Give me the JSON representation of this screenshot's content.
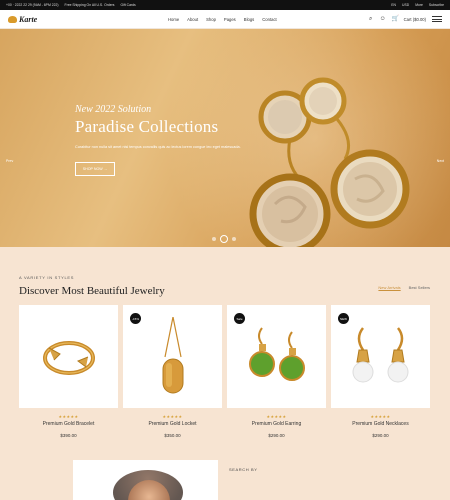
{
  "topbar": {
    "hours": "+00 · 2222 22 29 (9AM - 6PM 222)",
    "shipping": "Free Shipping On All U.S. Orders",
    "gift": "Gift Cards",
    "lang": "EN",
    "currency": "USD",
    "more": "More",
    "subscribe": "Subscribe"
  },
  "nav": {
    "logo_text": "Karte",
    "menu": [
      "Home",
      "About",
      "Shop",
      "Pages",
      "Blogs",
      "Contact"
    ],
    "cart_label": "Cart ($0.00)"
  },
  "hero": {
    "subtitle": "New 2022 Solution",
    "title": "Paradise Collections",
    "desc": "Curabitur non nulla sit amet nisl tempus convallis quis ac lectus lorem congue leo eget malesuada.",
    "button": "SHOP NOW →",
    "prev": "Prev",
    "next": "Next",
    "colors": {
      "accent": "#d99a2b",
      "hero_bg": "#d7a55f",
      "page_bg": "#f7e4d2"
    }
  },
  "section": {
    "kicker": "A VARIETY IN STYLES",
    "title": "Discover Most Beautiful Jewelry",
    "tabs": [
      "New Arrivals",
      "Best Sellers"
    ],
    "active_tab_index": 0
  },
  "products": [
    {
      "name": "Premium Gold Bracelet",
      "price": "$390.00",
      "badge": "",
      "rating": 5,
      "icon": "bracelet-icon"
    },
    {
      "name": "Premium Gold Locket",
      "price": "$350.00",
      "badge": "-15%",
      "rating": 5,
      "icon": "locket-icon"
    },
    {
      "name": "Premium Gold Earring",
      "price": "$290.00",
      "badge": "Sale",
      "rating": 5,
      "icon": "earring-icon"
    },
    {
      "name": "Premium Gold Necklaces",
      "price": "$290.00",
      "badge": "NEW",
      "rating": 5,
      "icon": "pearl-earring-icon"
    }
  ],
  "bottom": {
    "label": "SEARCH BY"
  }
}
